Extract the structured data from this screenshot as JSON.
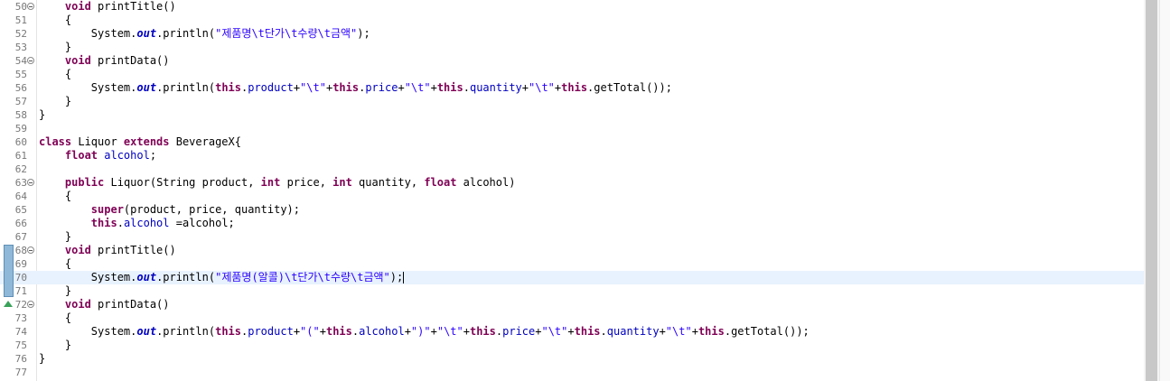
{
  "editor": {
    "current_line": "70",
    "lines": [
      {
        "num": "50",
        "fold": true,
        "override": false,
        "changed": false,
        "tokens": [
          [
            "",
            "    "
          ],
          [
            "kw",
            "void"
          ],
          [
            "",
            " printTitle()"
          ]
        ]
      },
      {
        "num": "51",
        "tokens": [
          [
            "",
            "    {"
          ]
        ]
      },
      {
        "num": "52",
        "tokens": [
          [
            "",
            "        System."
          ],
          [
            "sfld",
            "out"
          ],
          [
            "",
            ".println("
          ],
          [
            "str",
            "\"제품명\\t단가\\t수량\\t금액\""
          ],
          [
            "",
            ");"
          ]
        ]
      },
      {
        "num": "53",
        "tokens": [
          [
            "",
            "    }"
          ]
        ]
      },
      {
        "num": "54",
        "fold": true,
        "tokens": [
          [
            "",
            "    "
          ],
          [
            "kw",
            "void"
          ],
          [
            "",
            " printData()"
          ]
        ]
      },
      {
        "num": "55",
        "tokens": [
          [
            "",
            "    {"
          ]
        ]
      },
      {
        "num": "56",
        "tokens": [
          [
            "",
            "        System."
          ],
          [
            "sfld",
            "out"
          ],
          [
            "",
            ".println("
          ],
          [
            "kw",
            "this"
          ],
          [
            "",
            "."
          ],
          [
            "fld",
            "product"
          ],
          [
            "",
            "+"
          ],
          [
            "str",
            "\"\\t\""
          ],
          [
            "",
            "+"
          ],
          [
            "kw",
            "this"
          ],
          [
            "",
            "."
          ],
          [
            "fld",
            "price"
          ],
          [
            "",
            "+"
          ],
          [
            "str",
            "\"\\t\""
          ],
          [
            "",
            "+"
          ],
          [
            "kw",
            "this"
          ],
          [
            "",
            "."
          ],
          [
            "fld",
            "quantity"
          ],
          [
            "",
            "+"
          ],
          [
            "str",
            "\"\\t\""
          ],
          [
            "",
            "+"
          ],
          [
            "kw",
            "this"
          ],
          [
            "",
            ".getTotal());"
          ]
        ]
      },
      {
        "num": "57",
        "tokens": [
          [
            "",
            "    }"
          ]
        ]
      },
      {
        "num": "58",
        "tokens": [
          [
            "",
            "}"
          ]
        ]
      },
      {
        "num": "59",
        "tokens": []
      },
      {
        "num": "60",
        "tokens": [
          [
            "kw",
            "class"
          ],
          [
            "",
            " Liquor "
          ],
          [
            "kw",
            "extends"
          ],
          [
            "",
            " BeverageX{"
          ]
        ]
      },
      {
        "num": "61",
        "tokens": [
          [
            "",
            "    "
          ],
          [
            "kw",
            "float"
          ],
          [
            "",
            ""
          ],
          [
            "fld",
            " alcohol"
          ],
          [
            "",
            ";"
          ]
        ]
      },
      {
        "num": "62",
        "tokens": []
      },
      {
        "num": "63",
        "fold": true,
        "tokens": [
          [
            "",
            "    "
          ],
          [
            "kw",
            "public"
          ],
          [
            "",
            " Liquor(String product, "
          ],
          [
            "kw",
            "int"
          ],
          [
            "",
            " price, "
          ],
          [
            "kw",
            "int"
          ],
          [
            "",
            " quantity, "
          ],
          [
            "kw",
            "float"
          ],
          [
            "",
            " alcohol)"
          ]
        ]
      },
      {
        "num": "64",
        "tokens": [
          [
            "",
            "    {"
          ]
        ]
      },
      {
        "num": "65",
        "tokens": [
          [
            "",
            "        "
          ],
          [
            "kw",
            "super"
          ],
          [
            "",
            "(product, price, quantity);"
          ]
        ]
      },
      {
        "num": "66",
        "tokens": [
          [
            "",
            "        "
          ],
          [
            "kw",
            "this"
          ],
          [
            "",
            "."
          ],
          [
            "fld",
            "alcohol"
          ],
          [
            "",
            " =alcohol;"
          ]
        ]
      },
      {
        "num": "67",
        "tokens": [
          [
            "",
            "    }"
          ]
        ]
      },
      {
        "num": "68",
        "fold": true,
        "override": true,
        "changed": true,
        "tokens": [
          [
            "",
            "    "
          ],
          [
            "kw",
            "void"
          ],
          [
            "",
            " printTitle()"
          ]
        ]
      },
      {
        "num": "69",
        "changed": true,
        "tokens": [
          [
            "",
            "    {"
          ]
        ]
      },
      {
        "num": "70",
        "changed": true,
        "caret": true,
        "tokens": [
          [
            "",
            "        System."
          ],
          [
            "sfld",
            "out"
          ],
          [
            "",
            ".println("
          ],
          [
            "str",
            "\"제품명(알콜)\\t단가\\t수량\\t금액\""
          ],
          [
            "",
            ");"
          ]
        ]
      },
      {
        "num": "71",
        "changed": true,
        "tokens": [
          [
            "",
            "    }"
          ]
        ]
      },
      {
        "num": "72",
        "fold": true,
        "override": true,
        "tokens": [
          [
            "",
            "    "
          ],
          [
            "kw",
            "void"
          ],
          [
            "",
            " printData()"
          ]
        ]
      },
      {
        "num": "73",
        "tokens": [
          [
            "",
            "    {"
          ]
        ]
      },
      {
        "num": "74",
        "tokens": [
          [
            "",
            "        System."
          ],
          [
            "sfld",
            "out"
          ],
          [
            "",
            ".println("
          ],
          [
            "kw",
            "this"
          ],
          [
            "",
            "."
          ],
          [
            "fld",
            "product"
          ],
          [
            "",
            "+"
          ],
          [
            "str",
            "\"(\""
          ],
          [
            "",
            "+"
          ],
          [
            "kw",
            "this"
          ],
          [
            "",
            "."
          ],
          [
            "fld",
            "alcohol"
          ],
          [
            "",
            "+"
          ],
          [
            "str",
            "\")\""
          ],
          [
            "",
            "+"
          ],
          [
            "str",
            "\"\\t\""
          ],
          [
            "",
            "+"
          ],
          [
            "kw",
            "this"
          ],
          [
            "",
            "."
          ],
          [
            "fld",
            "price"
          ],
          [
            "",
            "+"
          ],
          [
            "str",
            "\"\\t\""
          ],
          [
            "",
            "+"
          ],
          [
            "kw",
            "this"
          ],
          [
            "",
            "."
          ],
          [
            "fld",
            "quantity"
          ],
          [
            "",
            "+"
          ],
          [
            "str",
            "\"\\t\""
          ],
          [
            "",
            "+"
          ],
          [
            "kw",
            "this"
          ],
          [
            "",
            ".getTotal());"
          ]
        ]
      },
      {
        "num": "75",
        "tokens": [
          [
            "",
            "    }"
          ]
        ]
      },
      {
        "num": "76",
        "tokens": [
          [
            "",
            "}"
          ]
        ]
      },
      {
        "num": "77",
        "tokens": []
      }
    ]
  },
  "colors": {
    "keyword": "#7f0055",
    "field": "#0000c0",
    "string": "#2a00ff",
    "current_line": "#e8f2fe",
    "line_number": "#787878"
  },
  "icons": {
    "fold": "fold-collapse-icon",
    "override": "override-triangle-icon",
    "change": "quick-diff-change-marker"
  }
}
